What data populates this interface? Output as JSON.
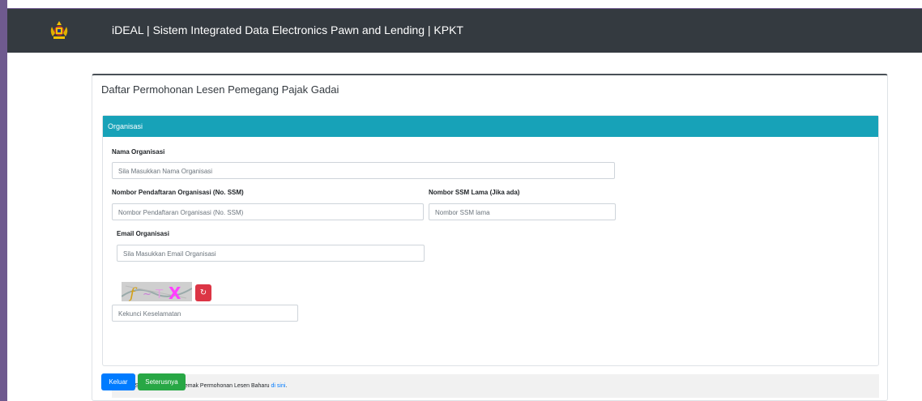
{
  "header": {
    "title": "iDEAL | Sistem Integrated Data Electronics Pawn and Lending | KPKT",
    "logo_icon": "malaysia-coat-of-arms-icon"
  },
  "page": {
    "title": "Daftar Permohonan Lesen Pemegang Pajak Gadai"
  },
  "section": {
    "title": "Organisasi"
  },
  "form": {
    "nama_label": "Nama Organisasi",
    "nama_placeholder": "Sila Masukkan Nama Organisasi",
    "ssm_label": "Nombor Pendaftaran Organisasi (No. SSM)",
    "ssm_placeholder": "Nombor Pendaftaran Organisasi (No. SSM)",
    "ssm_lama_label": "Nombor SSM Lama (Jika ada)",
    "ssm_lama_placeholder": "Nombor SSM lama",
    "email_label": "Email Organisasi",
    "email_placeholder": "Sila Masukkan Email Organisasi",
    "captcha_text": "fX",
    "captcha_placeholder": "Kekunci Keselamatan",
    "refresh_icon": "↻"
  },
  "note": {
    "text": "** Sila rujuk Senarai Semak Permohonan Lesen Baharu ",
    "link": "di sini",
    "end": "."
  },
  "buttons": {
    "back": "Keluar",
    "next": "Seterusnya"
  },
  "colors": {
    "header_bg": "#343a40",
    "section_header": "#17a2b8",
    "primary": "#007bff",
    "success": "#28a745",
    "danger": "#dc3545"
  }
}
